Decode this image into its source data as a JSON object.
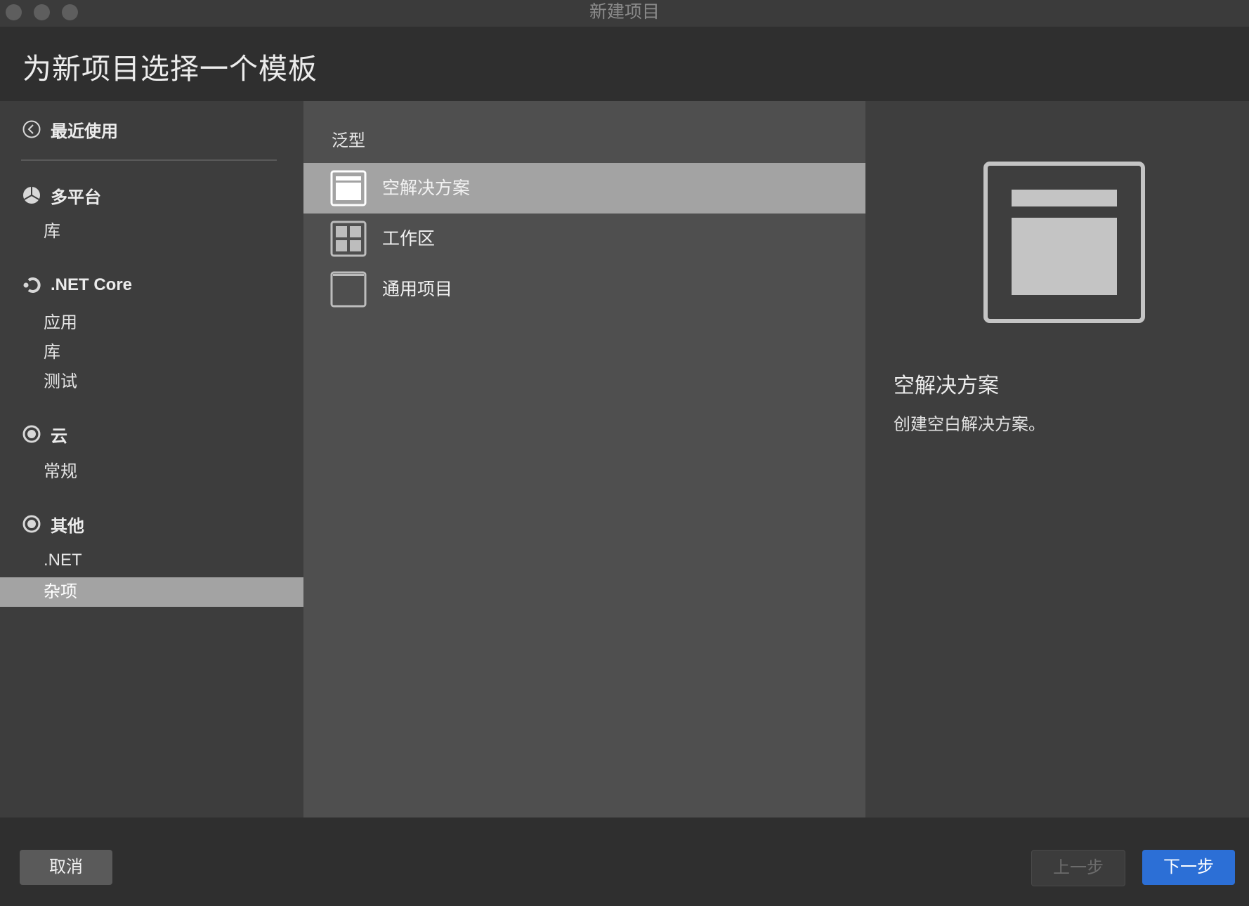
{
  "window": {
    "title": "新建项目"
  },
  "header": {
    "title": "为新项目选择一个模板"
  },
  "sidebar": {
    "recent_label": "最近使用",
    "categories": [
      {
        "label": "多平台",
        "icon": "pie-chart-icon",
        "subitems": [
          "库"
        ]
      },
      {
        "label": ".NET Core",
        "icon": "dotnet-core-icon",
        "subitems": [
          "应用",
          "库",
          "测试"
        ]
      },
      {
        "label": "云",
        "icon": "radio-circle-icon",
        "subitems": [
          "常规"
        ]
      },
      {
        "label": "其他",
        "icon": "radio-circle-icon",
        "subitems": [
          ".NET",
          "杂项"
        ]
      }
    ],
    "selected_subitem": "杂项"
  },
  "templates": {
    "section_title": "泛型",
    "items": [
      {
        "label": "空解决方案",
        "icon": "blank-solution-icon",
        "selected": true
      },
      {
        "label": "工作区",
        "icon": "workspace-grid-icon",
        "selected": false
      },
      {
        "label": "通用项目",
        "icon": "generic-project-icon",
        "selected": false
      }
    ]
  },
  "detail": {
    "title": "空解决方案",
    "description": "创建空白解决方案。",
    "preview_icon": "blank-solution-preview-icon"
  },
  "footer": {
    "cancel_label": "取消",
    "prev_label": "上一步",
    "next_label": "下一步"
  },
  "colors": {
    "accent": "#2c6fd6",
    "selection": "#a3a3a3",
    "background": "#323232"
  }
}
